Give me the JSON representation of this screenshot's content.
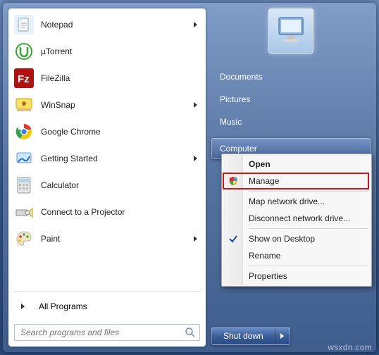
{
  "programs": [
    {
      "label": "Notepad",
      "iconbg": "#e8f2fb",
      "iconfg": "#4a7ab0",
      "glyph": "notepad",
      "hasSub": true
    },
    {
      "label": "µTorrent",
      "iconbg": "#ffffff",
      "iconfg": "#3aa83a",
      "glyph": "utorrent",
      "hasSub": false
    },
    {
      "label": "FileZilla",
      "iconbg": "#b11111",
      "iconfg": "#ffffff",
      "glyph": "filezilla",
      "hasSub": false
    },
    {
      "label": "WinSnap",
      "iconbg": "#f7f7a0",
      "iconfg": "#c97e00",
      "glyph": "winsnap",
      "hasSub": true
    },
    {
      "label": "Google Chrome",
      "iconbg": "#ffffff",
      "iconfg": "#000000",
      "glyph": "chrome",
      "hasSub": false
    },
    {
      "label": "Getting Started",
      "iconbg": "#e0f0ff",
      "iconfg": "#1f6fd6",
      "glyph": "getting",
      "hasSub": true
    },
    {
      "label": "Calculator",
      "iconbg": "#e9e9e9",
      "iconfg": "#5b5b5b",
      "glyph": "calc",
      "hasSub": false
    },
    {
      "label": "Connect to a Projector",
      "iconbg": "#e6e6e6",
      "iconfg": "#333333",
      "glyph": "projector",
      "hasSub": false
    },
    {
      "label": "Paint",
      "iconbg": "#ffffff",
      "iconfg": "#333333",
      "glyph": "paint",
      "hasSub": true
    }
  ],
  "all_programs_label": "All Programs",
  "search": {
    "placeholder": "Search programs and files"
  },
  "right_links": {
    "documents": "Documents",
    "pictures": "Pictures",
    "music": "Music",
    "computer": "Computer"
  },
  "shutdown": {
    "label": "Shut down"
  },
  "context_menu": {
    "open": "Open",
    "manage": "Manage",
    "map": "Map network drive...",
    "disconnect": "Disconnect network drive...",
    "show_desktop": "Show on Desktop",
    "rename": "Rename",
    "properties": "Properties"
  },
  "watermark": "wsxdn.com"
}
